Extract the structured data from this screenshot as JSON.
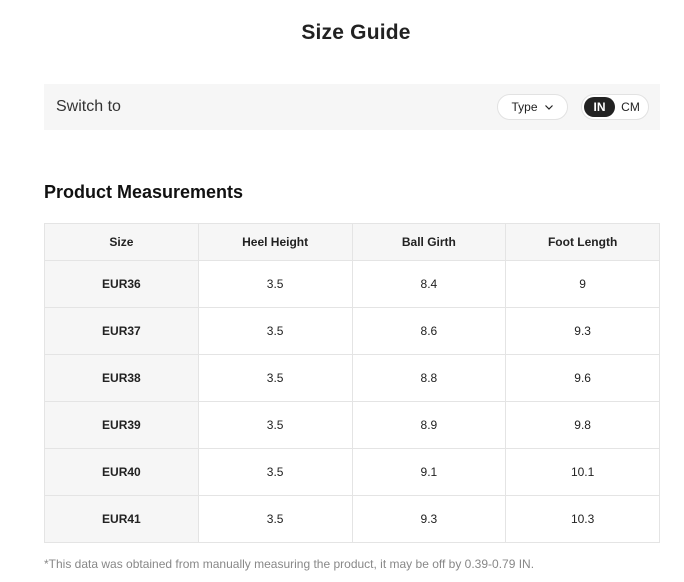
{
  "title": "Size Guide",
  "switch_bar": {
    "label": "Switch to",
    "type_dropdown": "Type",
    "units": [
      "IN",
      "CM"
    ],
    "active_unit": "IN"
  },
  "section_title": "Product Measurements",
  "table": {
    "headers": [
      "Size",
      "Heel Height",
      "Ball Girth",
      "Foot Length"
    ],
    "rows": [
      [
        "EUR36",
        "3.5",
        "8.4",
        "9"
      ],
      [
        "EUR37",
        "3.5",
        "8.6",
        "9.3"
      ],
      [
        "EUR38",
        "3.5",
        "8.8",
        "9.6"
      ],
      [
        "EUR39",
        "3.5",
        "8.9",
        "9.8"
      ],
      [
        "EUR40",
        "3.5",
        "9.1",
        "10.1"
      ],
      [
        "EUR41",
        "3.5",
        "9.3",
        "10.3"
      ]
    ]
  },
  "footnote": "*This data was obtained from manually measuring the product, it may be off by 0.39-0.79 IN.",
  "colors": {
    "accent": "#222222",
    "panel_bg": "#f6f6f6",
    "border": "#e4e4e4",
    "muted_text": "#888888"
  },
  "icons": {
    "dropdown": "chevron-down-icon"
  }
}
